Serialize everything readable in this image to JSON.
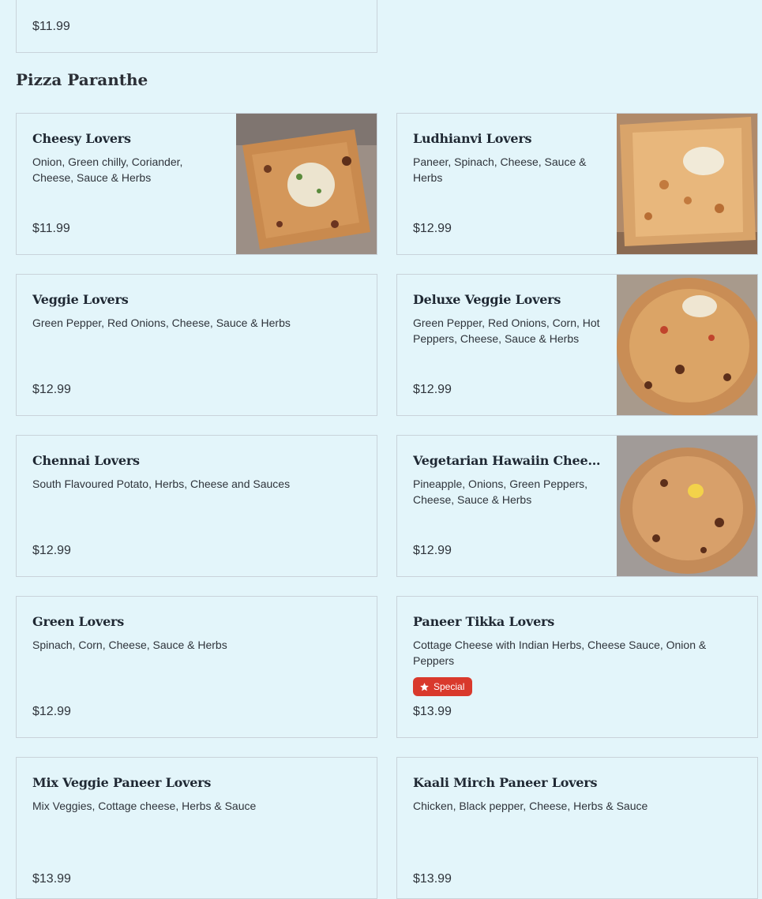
{
  "top_card": {
    "price": "$11.99"
  },
  "section": {
    "title": "Pizza Paranthe"
  },
  "items": [
    {
      "name": "Cheesy Lovers",
      "desc": "Onion, Green chilly, Coriander, Cheese, Sauce & Herbs",
      "price": "$11.99"
    },
    {
      "name": "Ludhianvi Lovers",
      "desc": "Paneer, Spinach, Cheese, Sauce & Herbs",
      "price": "$12.99"
    },
    {
      "name": "Veggie Lovers",
      "desc": "Green Pepper, Red Onions, Cheese, Sauce & Herbs",
      "price": "$12.99"
    },
    {
      "name": "Deluxe Veggie Lovers",
      "desc": "Green Pepper, Red Onions, Corn, Hot Peppers, Cheese, Sauce & Herbs",
      "price": "$12.99"
    },
    {
      "name": "Chennai Lovers",
      "desc": "South Flavoured Potato, Herbs, Cheese and Sauces",
      "price": "$12.99"
    },
    {
      "name": "Vegetarian Hawaiin Cheese Lovers",
      "desc": "Pineapple, Onions, Green Peppers, Cheese, Sauce & Herbs",
      "price": "$12.99"
    },
    {
      "name": "Green Lovers",
      "desc": "Spinach, Corn, Cheese, Sauce & Herbs",
      "price": "$12.99"
    },
    {
      "name": "Paneer Tikka Lovers",
      "desc": "Cottage Cheese with Indian Herbs, Cheese Sauce, Onion & Peppers",
      "price": "$13.99",
      "badge": "Special"
    },
    {
      "name": "Mix Veggie Paneer Lovers",
      "desc": "Mix Veggies, Cottage cheese, Herbs & Sauce",
      "price": "$13.99"
    },
    {
      "name": "Kaali Mirch Paneer Lovers",
      "desc": "Chicken, Black pepper, Cheese, Herbs & Sauce",
      "price": "$13.99"
    }
  ],
  "colors": {
    "background": "#e3f5fa",
    "border": "#c9d3da",
    "badge": "#d9392c"
  },
  "icons": {
    "badge_icon": "star-icon"
  }
}
